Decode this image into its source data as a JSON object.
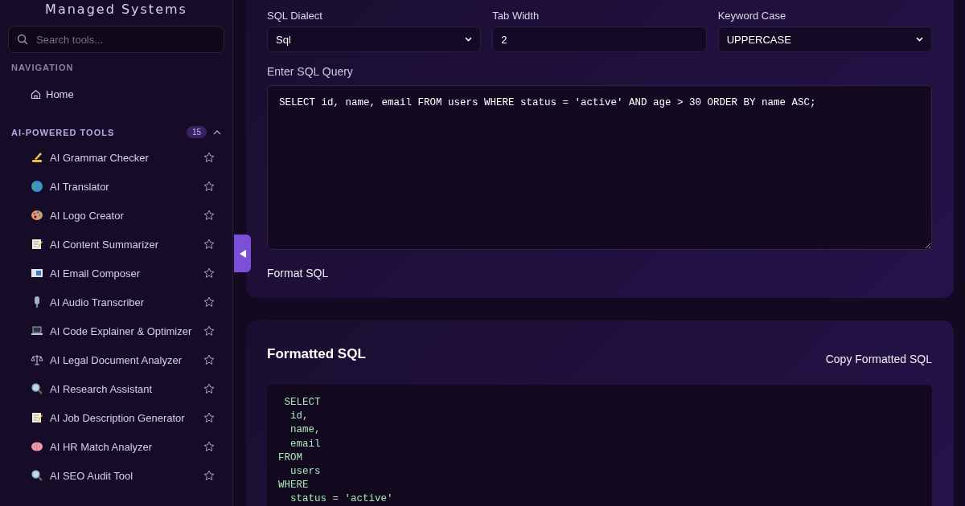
{
  "sidebar": {
    "brand": "Managed Systems",
    "search": {
      "placeholder": "Search tools..."
    },
    "navigation": {
      "heading": "NAVIGATION",
      "items": [
        {
          "label": "Home",
          "selected": false
        }
      ]
    },
    "section": {
      "heading": "AI-POWERED TOOLS",
      "count": "15",
      "expanded": true,
      "items": [
        {
          "label": "AI Grammar Checker",
          "favorite": false
        },
        {
          "label": "AI Translator",
          "favorite": false
        },
        {
          "label": "AI Logo Creator",
          "favorite": false
        },
        {
          "label": "AI Content Summarizer",
          "favorite": false
        },
        {
          "label": "AI Email Composer",
          "favorite": false
        },
        {
          "label": "AI Audio Transcriber",
          "favorite": false
        },
        {
          "label": "AI Code Explainer & Optimizer",
          "favorite": false
        },
        {
          "label": "AI Legal Document Analyzer",
          "favorite": false
        },
        {
          "label": "AI Research Assistant",
          "favorite": false
        },
        {
          "label": "AI Job Description Generator",
          "favorite": false
        },
        {
          "label": "AI HR Match Analyzer",
          "favorite": false
        },
        {
          "label": "AI SEO Audit Tool",
          "favorite": false
        }
      ]
    }
  },
  "options": [
    {
      "label": "SQL Dialect",
      "kind": "select",
      "value": "Sql"
    },
    {
      "label": "Tab Width",
      "kind": "input",
      "value": "2"
    },
    {
      "label": "Keyword Case",
      "kind": "select",
      "value": "UPPERCASE"
    }
  ],
  "query": {
    "label": "Enter SQL Query",
    "value": "SELECT id, name, email FROM users WHERE status = 'active' AND age > 30 ORDER BY name ASC;"
  },
  "format_button": "Format SQL",
  "output": {
    "title": "Formatted SQL",
    "copy_button": "Copy Formatted SQL",
    "lines": [
      " SELECT",
      "  id,",
      "  name,",
      "  email",
      "FROM",
      "  users",
      "WHERE",
      "  status = 'active'"
    ]
  }
}
